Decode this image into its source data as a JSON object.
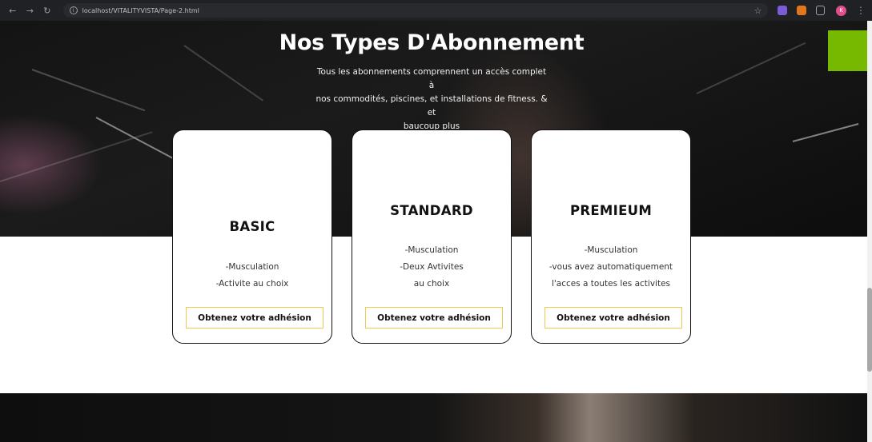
{
  "browser": {
    "url": "localhost/VITALITYVISTA/Page-2.html",
    "profile_initial": "K"
  },
  "hero": {
    "title": "Nos Types D'Abonnement",
    "subtitle_lines": [
      "Tous les abonnements comprennent un accès complet à",
      "nos commodités, piscines, et installations de fitness. & et",
      "baucoup plus"
    ]
  },
  "plans": [
    {
      "name": "BASIC",
      "features": [
        "-Musculation",
        "-Activite au choix"
      ],
      "cta": "Obtenez votre adhésion"
    },
    {
      "name": "STANDARD",
      "features": [
        "-Musculation",
        "-Deux Avtivites",
        "au choix"
      ],
      "cta": "Obtenez votre adhésion"
    },
    {
      "name": "PREMIEUM",
      "features": [
        "-Musculation",
        "-vous avez automatiquement",
        "l'acces a toutes les activites"
      ],
      "cta": "Obtenez votre adhésion"
    }
  ],
  "colors": {
    "accent_green": "#76b900",
    "cta_border": "#f2c84b",
    "bottom_heading": "#e9b000"
  },
  "icons": {
    "back": "arrow-left",
    "forward": "arrow-right",
    "reload": "reload",
    "site_info": "info",
    "bookmark": "star",
    "menu": "vertical-dots"
  }
}
